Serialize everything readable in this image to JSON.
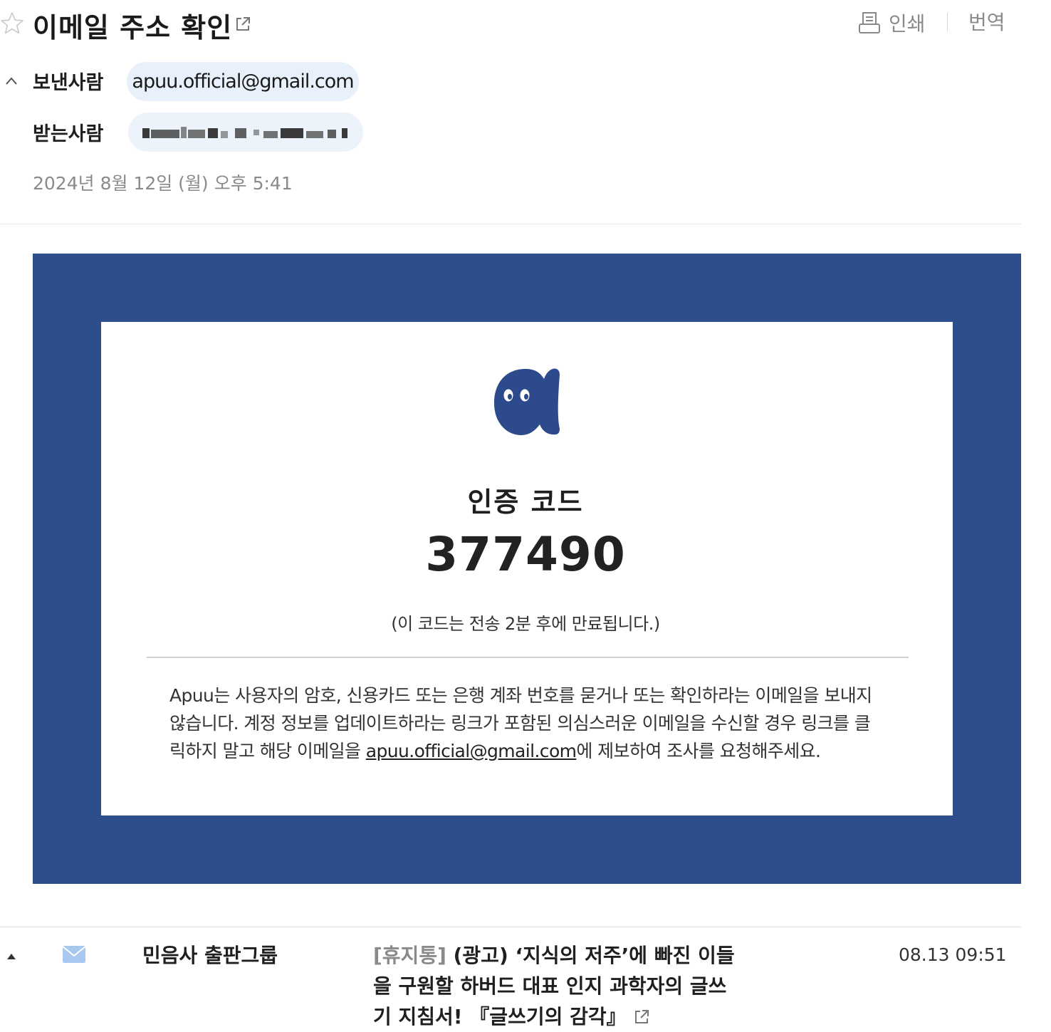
{
  "header": {
    "subject": "이메일 주소 확인",
    "toolbar": {
      "print_label": "인쇄",
      "translate_label": "번역"
    },
    "sender_label": "보낸사람",
    "sender_email": "apuu.official@gmail.com",
    "recipient_label": "받는사람",
    "sent_date": "2024년 8월 12일 (월) 오후 5:41"
  },
  "email_body": {
    "code_title": "인증 코드",
    "code_value": "377490",
    "code_expiry": "(이 코드는 전송 2분 후에 만료됩니다.)",
    "notice_before_link": "Apuu는 사용자의 암호, 신용카드 또는 은행 계좌 번호를 묻거나 또는 확인하라는 이메일을 보내지 않습니다. 계정 정보를 업데이트하라는 링크가 포함된 의심스러운 이메일을 수신할 경우 링크를 클릭하지 말고 해당 이메일을 ",
    "notice_link": "apuu.official@gmail.com",
    "notice_after_link": "에 제보하여 조사를 요청해주세요.",
    "frame_color": "#2e4d8c"
  },
  "next_mail": {
    "sender": "민음사 출판그룹",
    "tag": "[휴지통]",
    "subject": "(광고) ‘지식의 저주’에 빠진 이들을 구원할 하버드 대표 인지 과학자의 글쓰기 지침서! 『글쓰기의 감각』",
    "time": "08.13 09:51"
  },
  "icons": [
    "star-icon",
    "popout-icon",
    "print-icon",
    "collapse-icon",
    "brand-logo",
    "expand-icon",
    "mail-icon",
    "external-link-icon"
  ]
}
